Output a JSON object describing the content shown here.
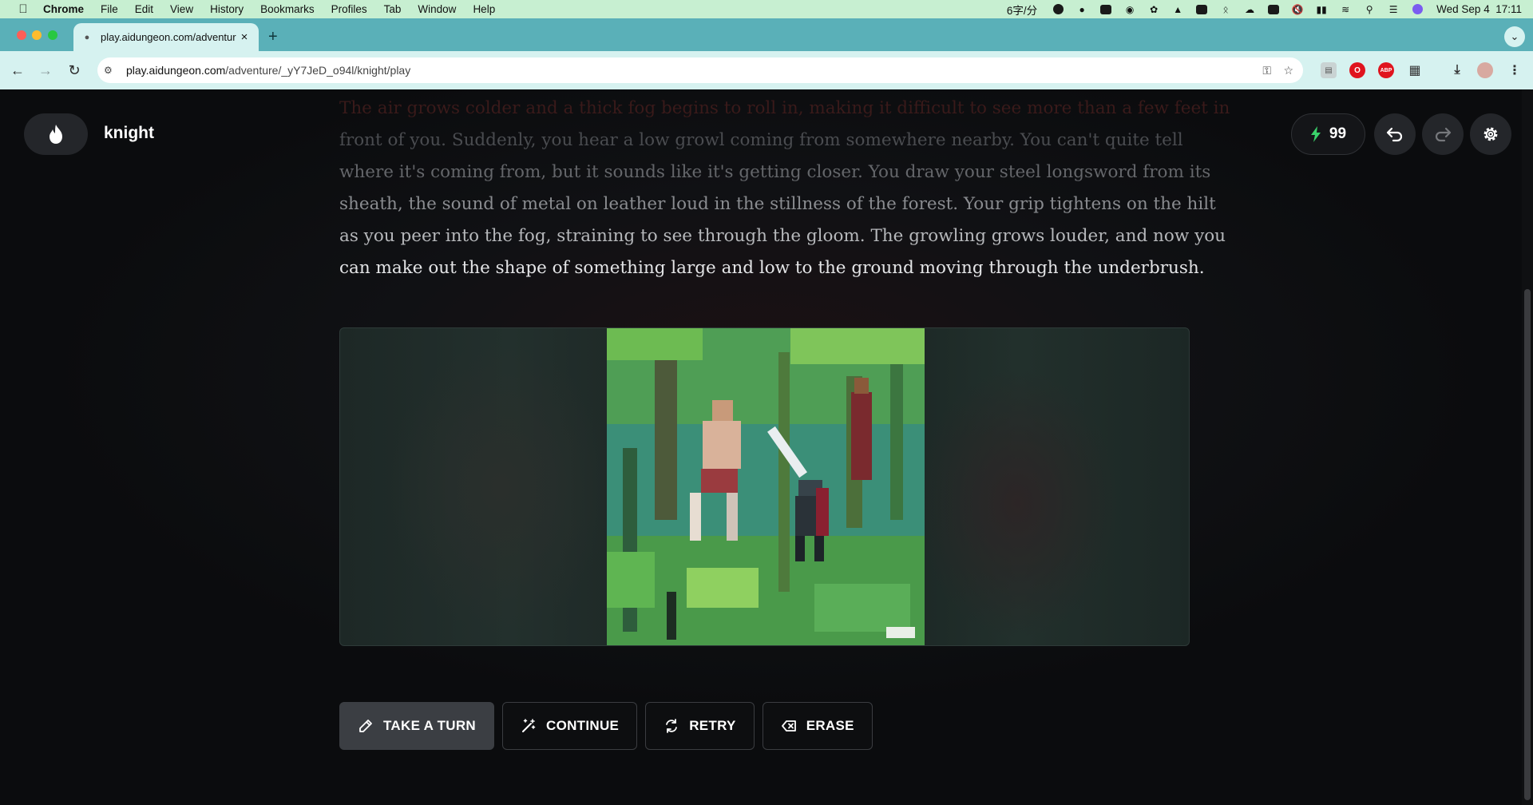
{
  "menubar": {
    "app": "Chrome",
    "items": [
      "File",
      "Edit",
      "View",
      "History",
      "Bookmarks",
      "Profiles",
      "Tab",
      "Window",
      "Help"
    ],
    "ime_text": "6字/分",
    "date": "Wed Sep 4",
    "time": "17:11"
  },
  "browser": {
    "tab_title": "play.aidungeon.com/adventur",
    "url_domain": "play.aidungeon.com",
    "url_path": "/adventure/_yY7JeD_o94l/knight/play",
    "extensions": [
      "ABP"
    ]
  },
  "header": {
    "adventure_title": "knight",
    "energy": "99"
  },
  "story": {
    "lines": [
      "The air grows colder and a thick fog begins to roll in, making it difficult to see more than a few feet in",
      "front of you. Suddenly, you hear a low growl coming from somewhere nearby. You can't quite tell",
      "where it's coming from, but it sounds like it's getting closer. You draw your steel longsword from its",
      "sheath, the sound of metal on leather loud in the stillness of the forest. Your grip tightens on the hilt",
      "as you peer into the fog, straining to see through the gloom. The growling grows louder, and now you",
      "can make out the shape of something large and low to the ground moving through the underbrush."
    ]
  },
  "actions": {
    "take_turn": "TAKE A TURN",
    "continue": "CONTINUE",
    "retry": "RETRY",
    "erase": "ERASE"
  },
  "colors": {
    "accent_green": "#3ad16a",
    "page_bg": "#0b0c0e",
    "tab_strip": "#5ab0b8"
  }
}
